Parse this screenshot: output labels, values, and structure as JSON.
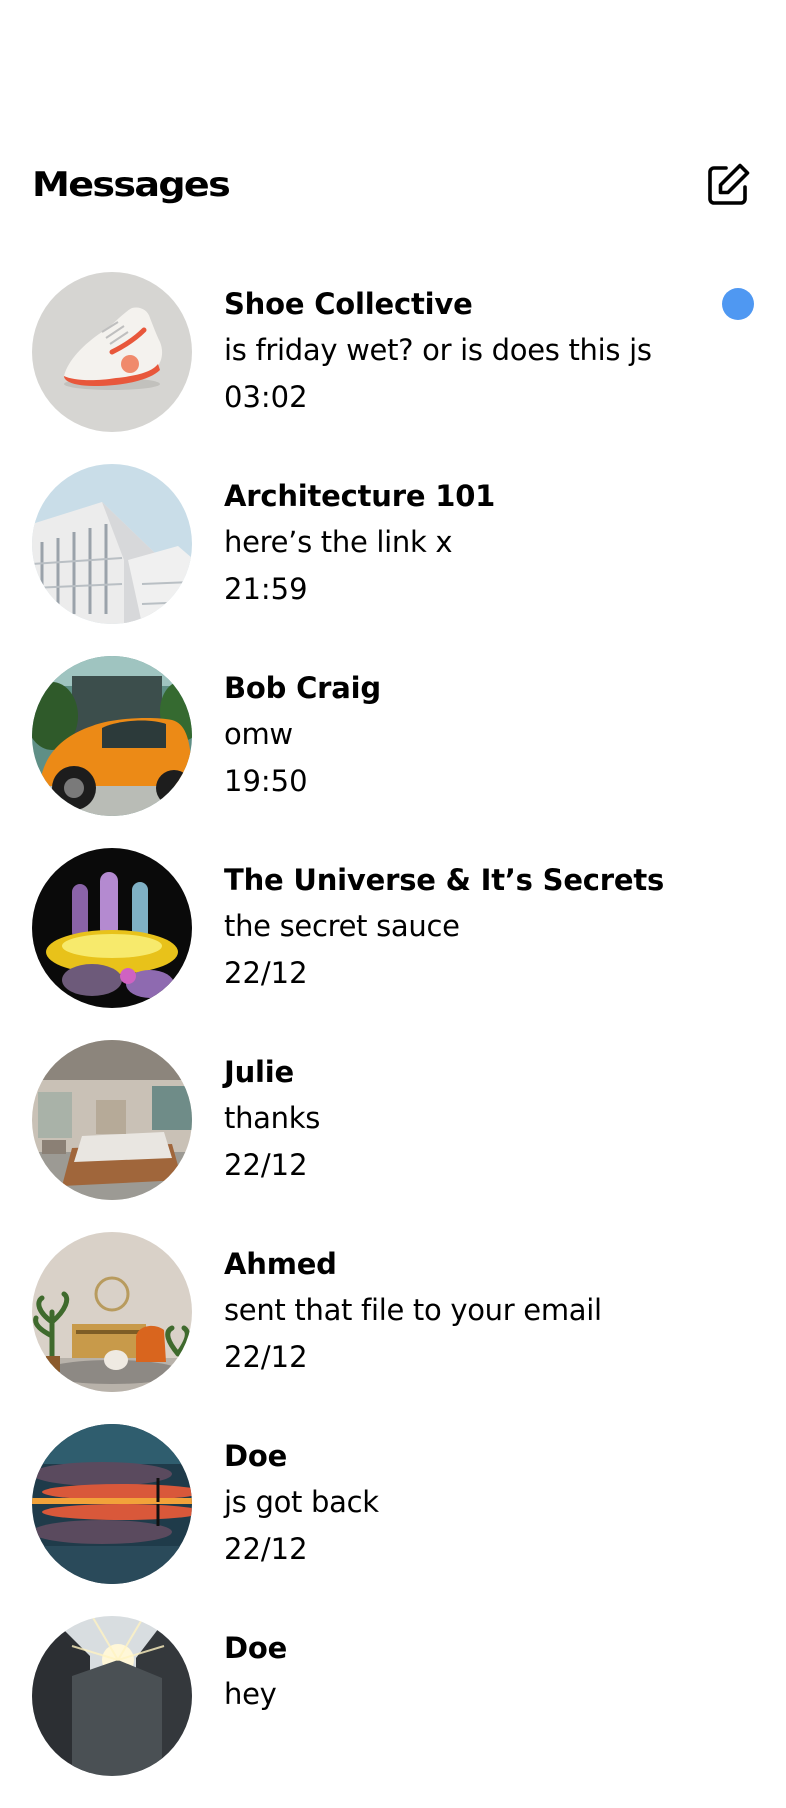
{
  "header": {
    "title": "Messages",
    "compose_icon": "compose-icon"
  },
  "accent_color": "#4f98f2",
  "conversations": [
    {
      "name": "Shoe Collective",
      "preview": "is friday wet? or is does this js",
      "time": "03:02",
      "unread": true,
      "avatar": "sneaker-photo"
    },
    {
      "name": "Architecture 101",
      "preview": "here’s the link x",
      "time": "21:59",
      "unread": false,
      "avatar": "building-photo"
    },
    {
      "name": "Bob Craig",
      "preview": "omw",
      "time": "19:50",
      "unread": false,
      "avatar": "orange-car-photo"
    },
    {
      "name": "The Universe & It’s Secrets",
      "preview": "the secret sauce",
      "time": "22/12",
      "unread": false,
      "avatar": "chrome-hand-photo"
    },
    {
      "name": "Julie",
      "preview": "thanks",
      "time": "22/12",
      "unread": false,
      "avatar": "bedroom-photo"
    },
    {
      "name": "Ahmed",
      "preview": "sent that file to your email",
      "time": "22/12",
      "unread": false,
      "avatar": "living-room-photo"
    },
    {
      "name": "Doe",
      "preview": "js got back",
      "time": "22/12",
      "unread": false,
      "avatar": "sunset-photo"
    },
    {
      "name": "Doe",
      "preview": "hey",
      "time": "",
      "unread": false,
      "avatar": "mountain-photo"
    }
  ]
}
